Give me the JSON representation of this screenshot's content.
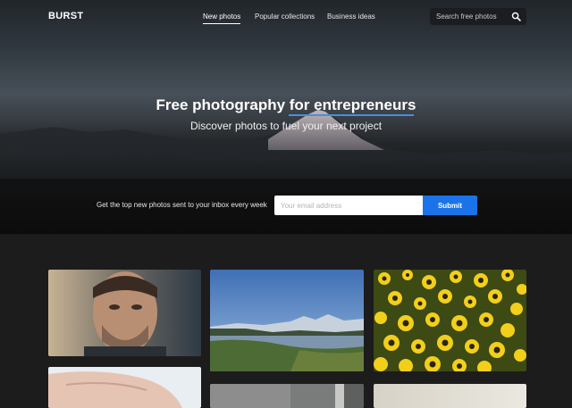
{
  "brand": {
    "logo": "BURST"
  },
  "nav": {
    "links": [
      {
        "label": "New photos",
        "active": true
      },
      {
        "label": "Popular collections",
        "active": false
      },
      {
        "label": "Business ideas",
        "active": false
      }
    ],
    "search_placeholder": "Search free photos",
    "search_icon": "search-icon"
  },
  "hero": {
    "title": "Free photography for entrepreneurs",
    "subtitle": "Discover photos to fuel your next project",
    "signup_text": "Get the top new photos sent to your inbox every week",
    "email_placeholder": "Your email address",
    "submit_label": "Submit"
  },
  "colors": {
    "accent": "#1a73e8",
    "underline": "#4a90d9",
    "page_background": "#1c1c1d"
  },
  "photos": [
    {
      "subject": "portrait-of-man"
    },
    {
      "subject": "mountain-lake-landscape"
    },
    {
      "subject": "yellow-flower-field"
    },
    {
      "subject": "close-up-skin"
    },
    {
      "subject": "grey-interior"
    },
    {
      "subject": "light-wall"
    }
  ]
}
